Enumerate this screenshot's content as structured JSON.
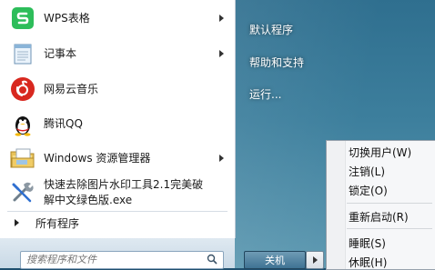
{
  "left_panel": {
    "programs": [
      {
        "label": "WPS表格",
        "icon": "wps-spreadsheet-icon",
        "has_arrow": true
      },
      {
        "label": "记事本",
        "icon": "notepad-icon",
        "has_arrow": true
      },
      {
        "label": "网易云音乐",
        "icon": "netease-music-icon",
        "has_arrow": false
      },
      {
        "label": "腾讯QQ",
        "icon": "qq-penguin-icon",
        "has_arrow": false
      },
      {
        "label": "Windows 资源管理器",
        "icon": "explorer-folder-icon",
        "has_arrow": true
      },
      {
        "label_line1": "快速去除图片水印工具2.1完美破",
        "label_line2": "解中文绿色版.exe",
        "icon": "tools-icon",
        "has_arrow": false
      }
    ],
    "all_programs": "所有程序",
    "search_placeholder": "搜索程序和文件"
  },
  "right_panel": {
    "top_cut": "",
    "items": [
      "默认程序",
      "帮助和支持",
      "运行..."
    ]
  },
  "shutdown": {
    "label": "关机"
  },
  "power_menu": {
    "items": [
      "切换用户(W)",
      "注销(L)",
      "锁定(O)",
      "重新启动(R)",
      "睡眠(S)",
      "休眠(H)"
    ]
  },
  "colors": {
    "wps_green": "#2dbd5a",
    "netease_red": "#d8281f",
    "pane_blue": "#3d7f9d"
  }
}
